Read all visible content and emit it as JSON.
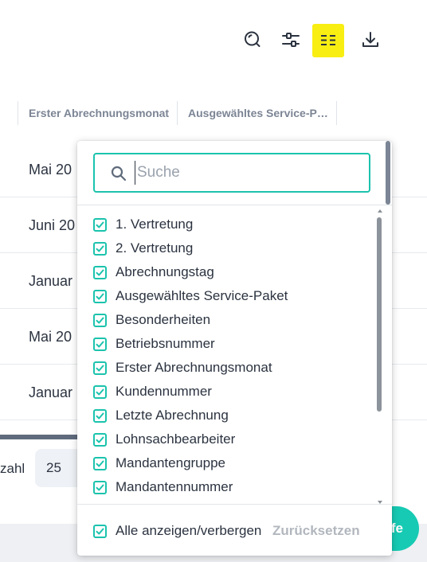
{
  "toolbar": {
    "search_icon": "search-icon",
    "filter_icon": "sliders-icon",
    "columns_icon": "columns-icon",
    "download_icon": "download-icon",
    "columns_highlight": "#f8ee12"
  },
  "table": {
    "headers": [
      "Erster Abrechnungsmonat",
      "Ausgewähltes Service-P…"
    ],
    "rows": [
      "Mai 20",
      "Juni 20",
      "Januar",
      "Mai 20",
      "Januar"
    ]
  },
  "pager": {
    "label": "zahl",
    "page_size": "25"
  },
  "apply_button": {
    "label": "fe"
  },
  "dropdown": {
    "search_placeholder": "Suche",
    "search_value": "",
    "options": [
      {
        "label": "1. Vertretung",
        "checked": true
      },
      {
        "label": "2. Vertretung",
        "checked": true
      },
      {
        "label": "Abrechnungstag",
        "checked": true
      },
      {
        "label": "Ausgewähltes Service-Paket",
        "checked": true
      },
      {
        "label": "Besonderheiten",
        "checked": true
      },
      {
        "label": "Betriebsnummer",
        "checked": true
      },
      {
        "label": "Erster Abrechnungsmonat",
        "checked": true
      },
      {
        "label": "Kundennummer",
        "checked": true
      },
      {
        "label": "Letzte Abrechnung",
        "checked": true
      },
      {
        "label": "Lohnsachbearbeiter",
        "checked": true
      },
      {
        "label": "Mandantengruppe",
        "checked": true
      },
      {
        "label": "Mandantennummer",
        "checked": true
      }
    ],
    "show_all_label": "Alle anzeigen/verbergen",
    "show_all_checked": true,
    "reset_label": "Zurücksetzen"
  },
  "colors": {
    "accent": "#1bc3ad",
    "primary_button": "#17cab3",
    "text": "#2b3340",
    "muted": "#7c8595"
  }
}
